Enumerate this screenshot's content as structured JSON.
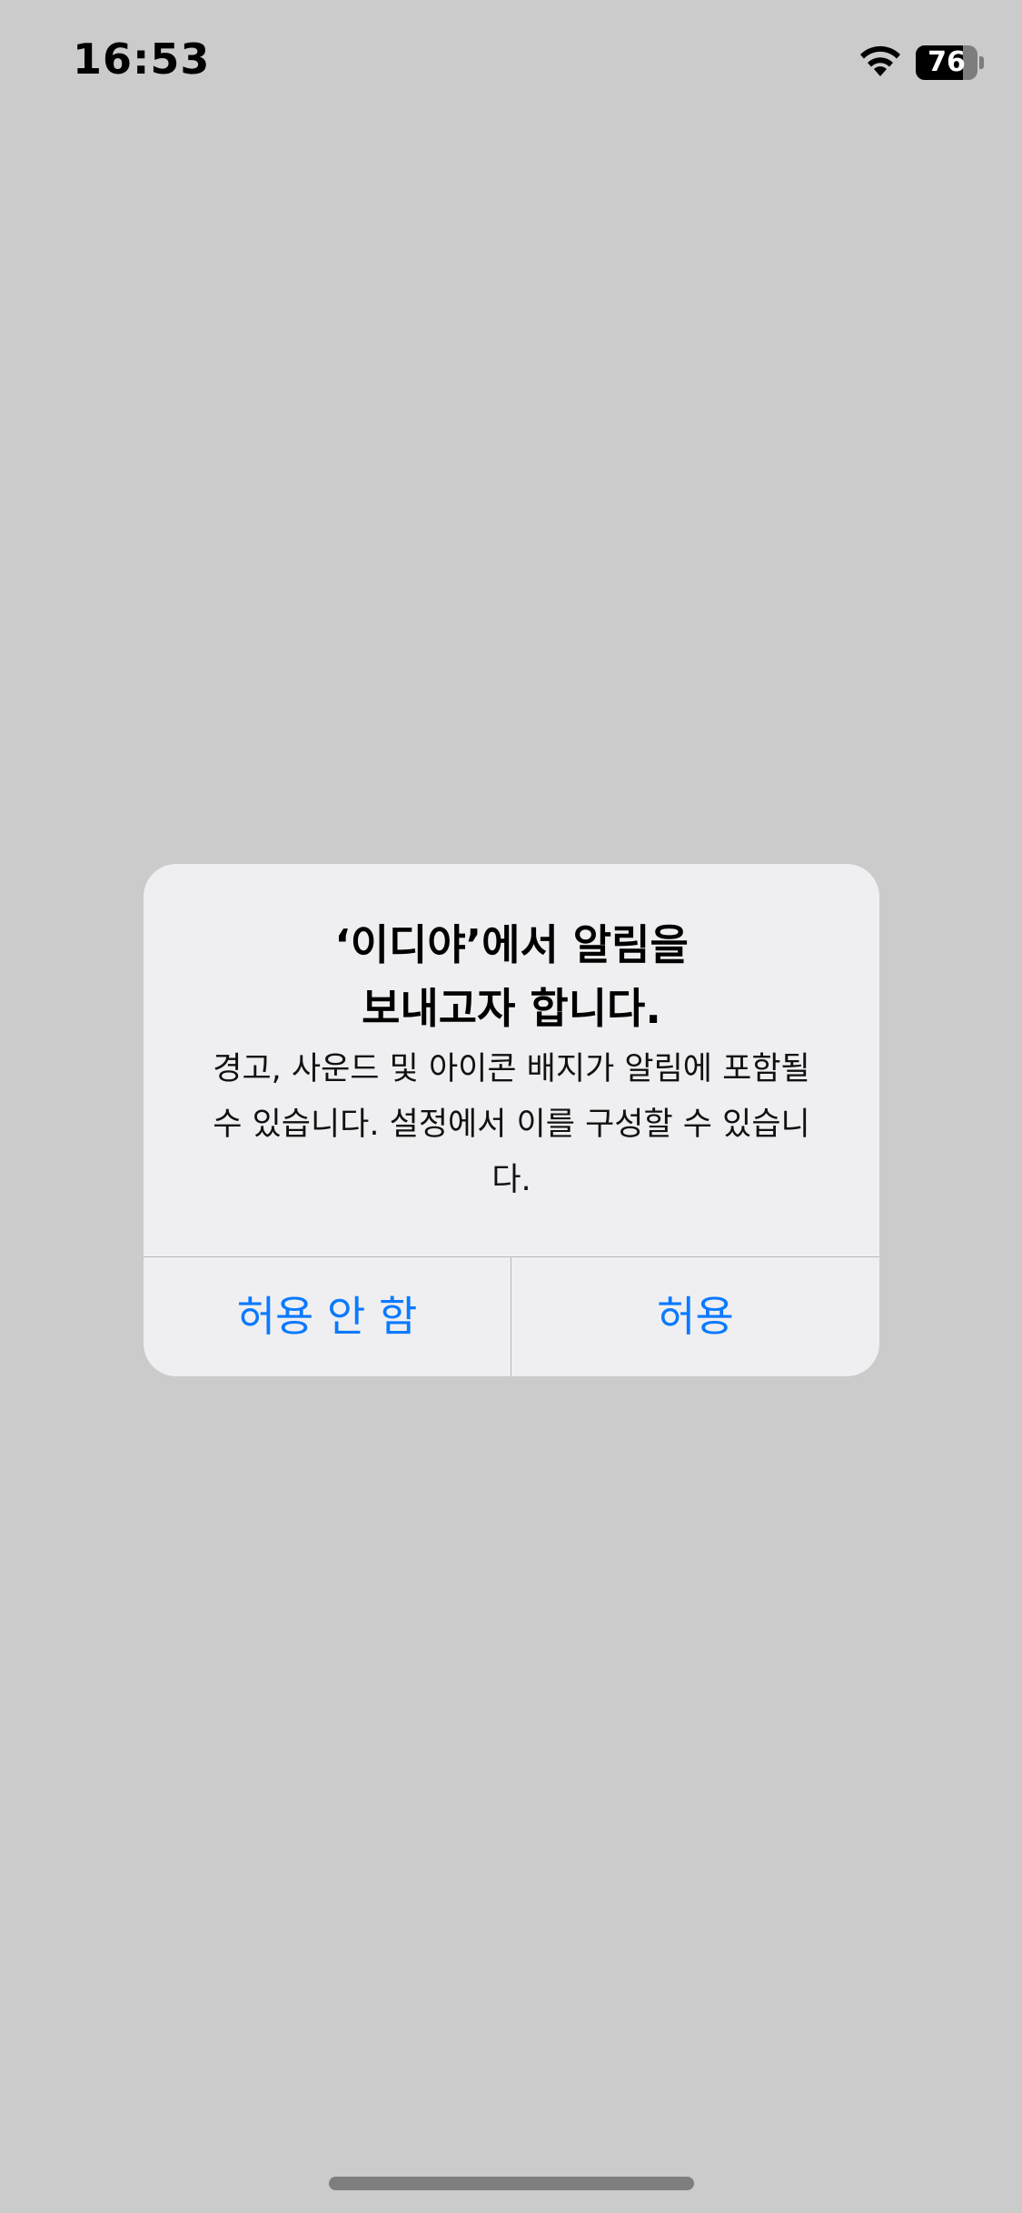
{
  "status_bar": {
    "time": "16:53",
    "battery_level": "76",
    "battery_fraction": 0.76,
    "icons": [
      "wifi-icon",
      "battery-icon"
    ]
  },
  "alert": {
    "title": "‘이디야’에서 알림을\n보내고자 합니다.",
    "message": "경고, 사운드 및 아이콘 배지가 알림에 포함될 수 있습니다. 설정에서 이를 구성할 수 있습니다.",
    "buttons": {
      "deny": "허용 안 함",
      "allow": "허용"
    }
  },
  "colors": {
    "background": "#cbcbcb",
    "alert_background": "#efeff1",
    "accent": "#0a7aff",
    "separator": "#b9b9bd"
  }
}
